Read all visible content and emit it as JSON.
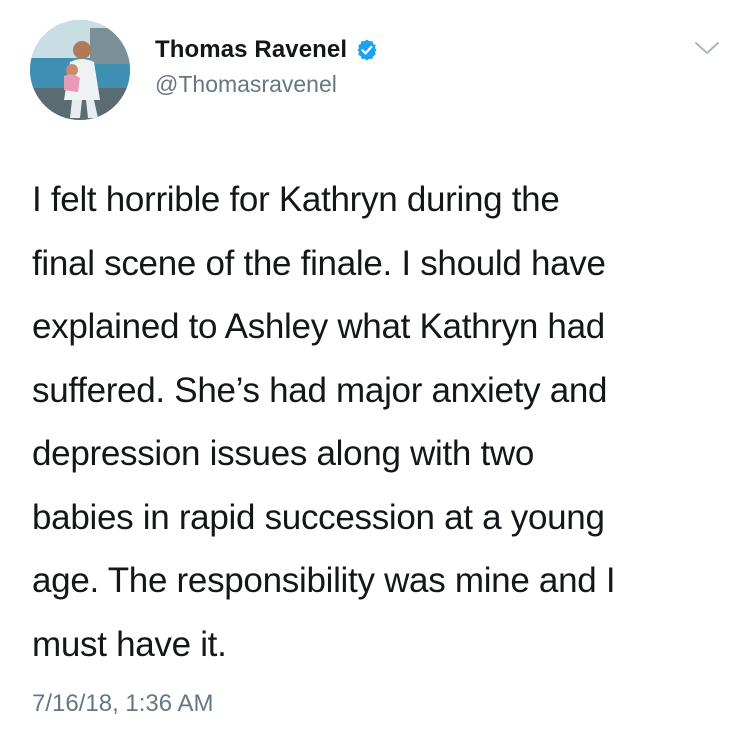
{
  "tweet": {
    "author": {
      "display_name": "Thomas Ravenel",
      "handle": "@Thomasravenel",
      "verified": true
    },
    "text": "I felt horrible for Kathryn during the\nfinal scene of the finale.  I should have\nexplained to Ashley what Kathryn had\nsuffered. She’s had major anxiety and\ndepression issues along with two\nbabies in rapid succession at a young\nage.  The responsibility was mine and I\nmust have it.",
    "timestamp": "7/16/18, 1:36 AM"
  },
  "icons": {
    "verified": "verified-badge-icon",
    "menu": "chevron-down-icon"
  },
  "colors": {
    "verified_blue": "#1da1f2",
    "secondary_text": "#657786",
    "primary_text": "#14171a",
    "caret_gray": "#aab8c2"
  }
}
